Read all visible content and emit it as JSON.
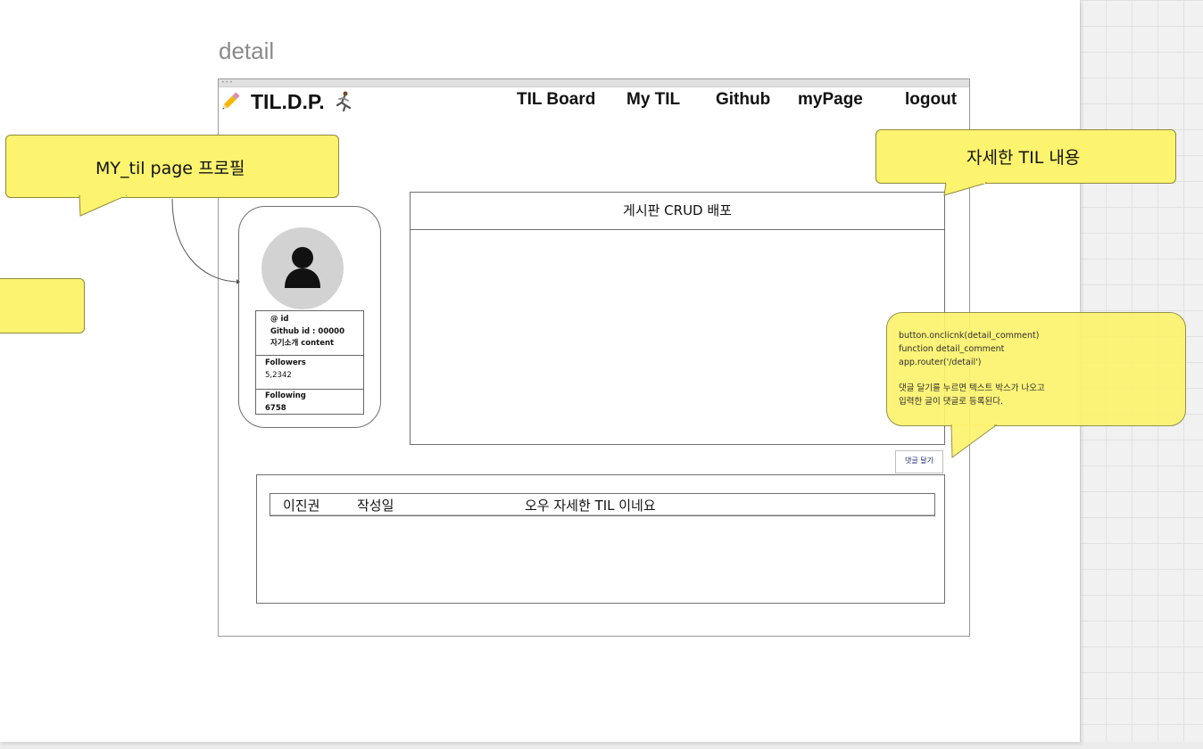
{
  "frame": {
    "label": "detail"
  },
  "header": {
    "logo": "TIL.D.P.",
    "nav": [
      "TIL Board",
      "My TIL",
      "Github",
      "myPage",
      "logout"
    ]
  },
  "profile": {
    "handle": "@ id",
    "github": "Github id : 00000",
    "bio": "자기소개 content",
    "followers_label": "Followers",
    "followers_value": "5,2342",
    "following_label": "Following",
    "following_value": "6758"
  },
  "post": {
    "title": "게시판 CRUD 배포"
  },
  "comment_button": "댓글 달기",
  "comment": {
    "author": "이진권",
    "date_label": "작성일",
    "text": "오우 자세한 TIL 이네요"
  },
  "notes": {
    "profile_note": "MY_til page 프로필",
    "detail_note": "자세한 TIL 내용",
    "code_lines": [
      "button.onclicnk(detail_comment)",
      "function detail_comment",
      "app.router('/detail')",
      "",
      "댓글 달기를 누르면 텍스트 박스가 나오고",
      "입력한 글이 댓글로 등록된다."
    ]
  },
  "colors": {
    "sticky": "#fcf36e",
    "avatar_bg": "#d2d2d2"
  }
}
